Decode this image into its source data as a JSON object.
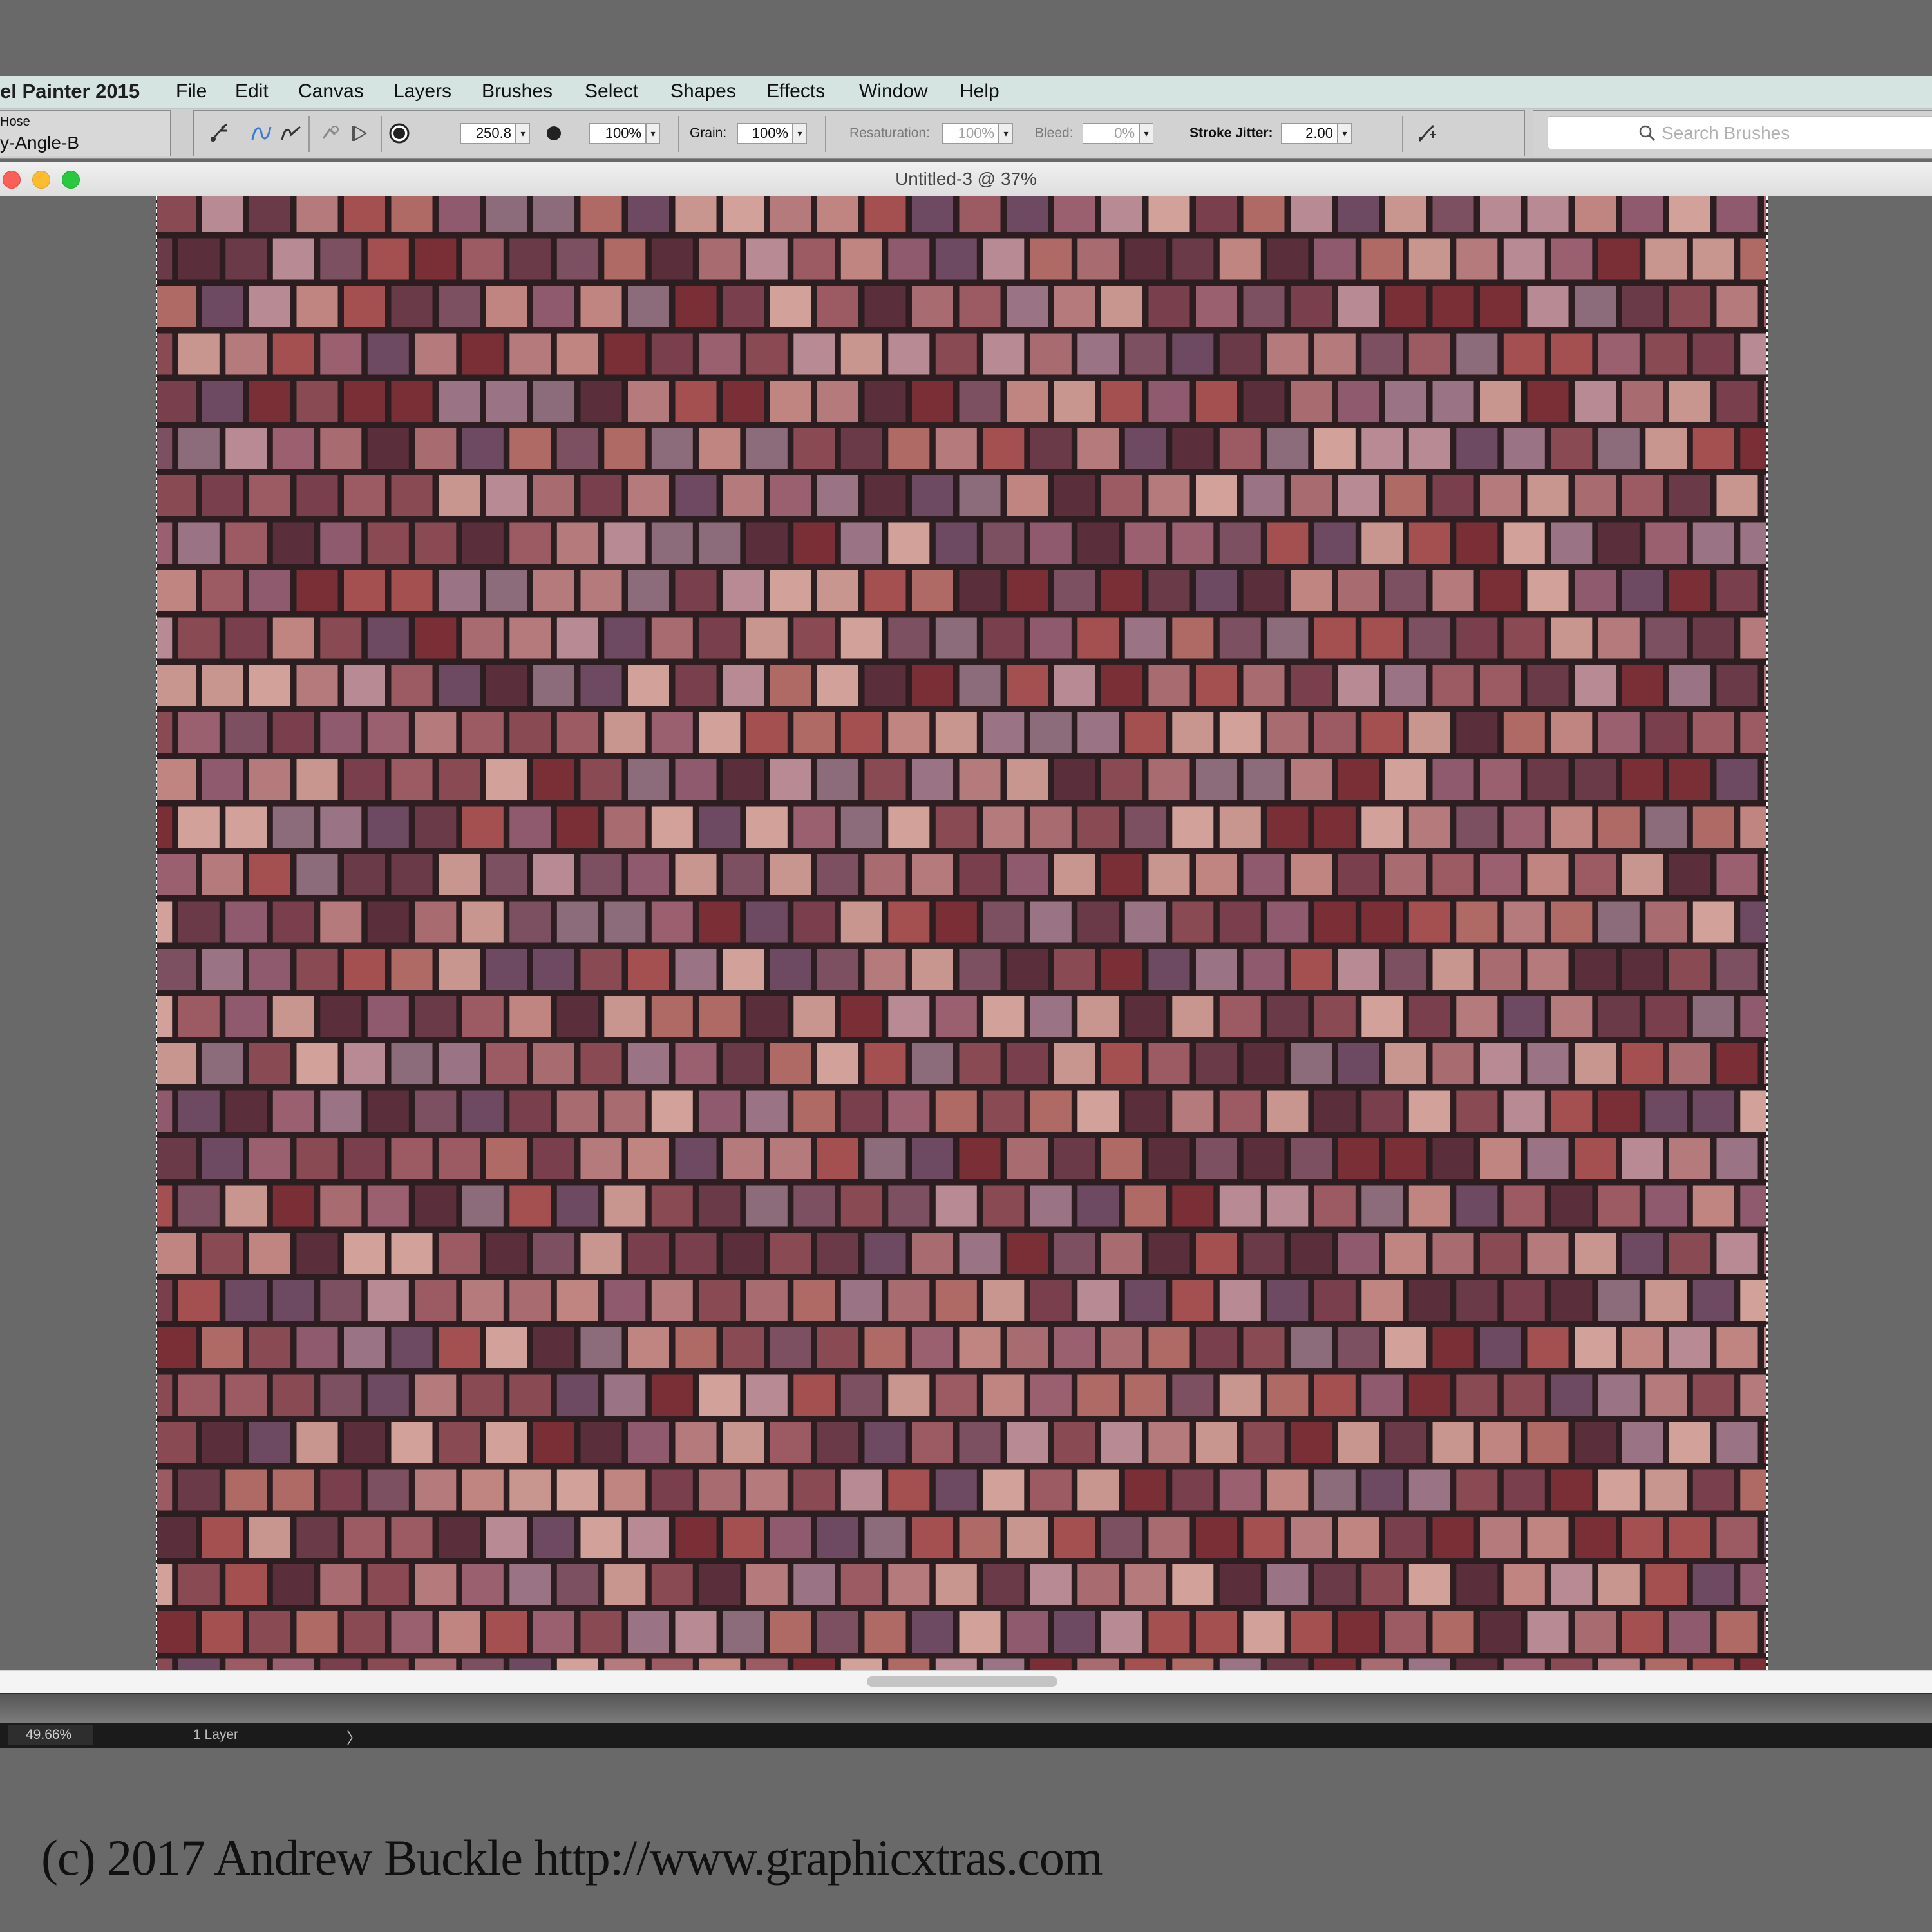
{
  "app": {
    "title_fragment": "el Painter 2015",
    "menu": [
      "File",
      "Edit",
      "Canvas",
      "Layers",
      "Brushes",
      "Select",
      "Shapes",
      "Effects",
      "Window",
      "Help"
    ]
  },
  "brush_selector": {
    "category": "Hose",
    "variant": "y-Angle-B"
  },
  "property_bar": {
    "icons": [
      "image-hose-tool-icon",
      "freehand-stroke-icon",
      "straight-stroke-icon",
      "reset-tool-icon",
      "brush-ghost-icon",
      "size-dot-icon",
      "opacity-dot-icon",
      "brush-calibration-icon"
    ],
    "size_value": "250.8",
    "opacity_value": "100%",
    "grain_label": "Grain:",
    "grain_value": "100%",
    "resaturation_label": "Resaturation:",
    "resaturation_value": "100%",
    "bleed_label": "Bleed:",
    "bleed_value": "0%",
    "stroke_jitter_label": "Stroke Jitter:",
    "stroke_jitter_value": "2.00"
  },
  "search": {
    "placeholder": "Search Brushes"
  },
  "document": {
    "title": "Untitled-3 @ 37%",
    "window_controls": [
      "close-button",
      "minimize-button",
      "zoom-button"
    ],
    "tile_palette": [
      "#8a4a54",
      "#9c5a62",
      "#7a3f4c",
      "#a86b6f",
      "#b47a7c",
      "#6a3a48",
      "#8f5a6e",
      "#c08580",
      "#5a2e3a",
      "#9a6070",
      "#b06a66",
      "#7c5060",
      "#c9968f",
      "#6e4a62",
      "#a45050",
      "#8c6c7a",
      "#d2a19a",
      "#7a2f36",
      "#b88a94",
      "#9a7484"
    ]
  },
  "status": {
    "zoom": "49.66%",
    "layers": "1 Layer",
    "arrow": "〉"
  },
  "watermark": "(c) 2017 Andrew Buckle http://www.graphicxtras.com"
}
